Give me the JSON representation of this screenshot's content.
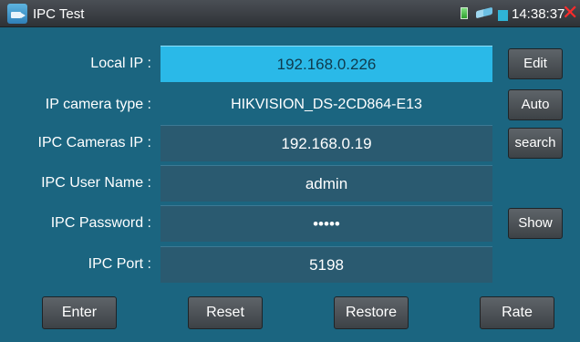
{
  "titlebar": {
    "title": "IPC Test",
    "clock": "14:38:37",
    "close_glyph": "✕",
    "icons": [
      "ipc-test-app-icon",
      "file-status-icon",
      "network-status-icon",
      "battery-icon",
      "close-icon"
    ]
  },
  "colors": {
    "background": "#1b6580",
    "field": "#2a5a70",
    "active_field": "#2ab9e8",
    "button": "#4a4f54",
    "close": "#ff2a2a"
  },
  "form": {
    "local_ip": {
      "label": "Local IP :",
      "value": "192.168.0.226"
    },
    "camera_type": {
      "label": "IP camera type :",
      "value": "HIKVISION_DS-2CD864-E13"
    },
    "cameras_ip": {
      "label": "IPC Cameras IP :",
      "value": "192.168.0.19"
    },
    "user_name": {
      "label": "IPC User Name :",
      "value": "admin"
    },
    "password": {
      "label": "IPC Password :",
      "value": "•••••"
    },
    "port": {
      "label": "IPC Port :",
      "value": "5198"
    }
  },
  "side_buttons": {
    "edit": "Edit",
    "auto": "Auto",
    "search": "search",
    "show": "Show"
  },
  "bottom_buttons": {
    "enter": "Enter",
    "reset": "Reset",
    "restore": "Restore",
    "rate": "Rate"
  }
}
